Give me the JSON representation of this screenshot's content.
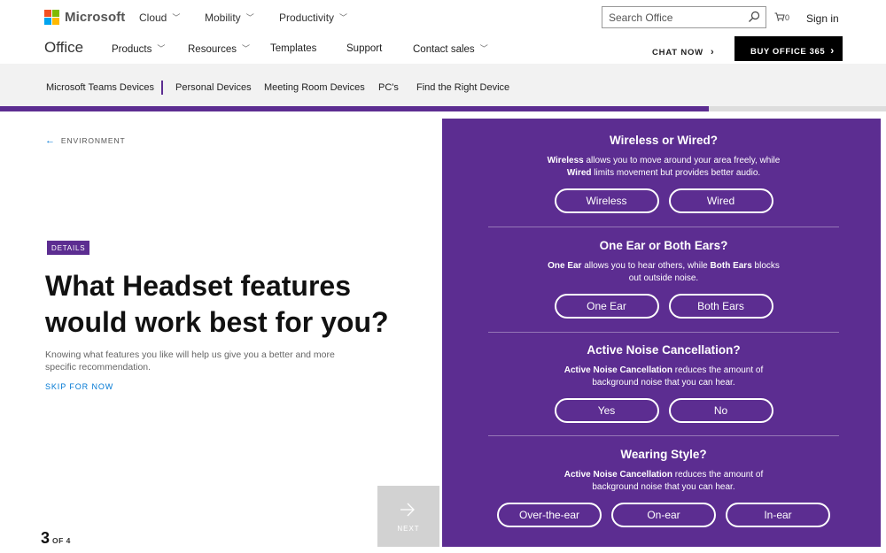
{
  "colors": {
    "accent": "#5c2d91",
    "link": "#0078d4",
    "ms_red": "#f25022",
    "ms_green": "#7fba00",
    "ms_blue": "#00a4ef",
    "ms_yellow": "#ffb900"
  },
  "header": {
    "brand": "Microsoft",
    "nav": [
      "Cloud",
      "Mobility",
      "Productivity"
    ],
    "search_placeholder": "Search Office",
    "cart_count": "0",
    "sign_in": "Sign in"
  },
  "office_nav": {
    "title": "Office",
    "items": [
      "Products",
      "Resources",
      "Templates",
      "Support",
      "Contact sales"
    ],
    "chat": "CHAT NOW",
    "buy": "BUY OFFICE 365"
  },
  "subnav": [
    "Microsoft Teams Devices",
    "Personal Devices",
    "Meeting Room Devices",
    "PC's",
    "Find the Right Device"
  ],
  "progress": 0.8,
  "main": {
    "back": "ENVIRONMENT",
    "badge": "DETAILS",
    "heading": "What Headset features would work best for you?",
    "description": "Knowing what features you like will help us give you a better and more specific recommendation.",
    "skip": "SKIP FOR NOW",
    "step_current": "3",
    "step_total": "OF 4",
    "next": "NEXT"
  },
  "questions": [
    {
      "title": "Wireless or Wired?",
      "desc": [
        {
          "bold": "Wireless",
          "text": " allows you to move around your area freely, while"
        },
        {
          "bold": "Wired",
          "text": " limits movement but provides better audio."
        }
      ],
      "options": [
        "Wireless",
        "Wired"
      ]
    },
    {
      "title": "One Ear or Both Ears?",
      "desc": [
        {
          "bold": "One Ear",
          "text": " allows you to hear others, while ",
          "bold2": "Both Ears",
          "text2": " blocks"
        },
        {
          "bold": "",
          "text": "out outside noise."
        }
      ],
      "options": [
        "One Ear",
        "Both Ears"
      ]
    },
    {
      "title": "Active Noise Cancellation?",
      "desc": [
        {
          "bold": "Active Noise Cancellation",
          "text": " reduces the amount of"
        },
        {
          "bold": "",
          "text": "background noise that you can hear."
        }
      ],
      "options": [
        "Yes",
        "No"
      ]
    },
    {
      "title": "Wearing Style?",
      "desc": [
        {
          "bold": "Active Noise Cancellation",
          "text": " reduces the amount of"
        },
        {
          "bold": "",
          "text": "background noise that you can hear."
        }
      ],
      "options": [
        "Over-the-ear",
        "On-ear",
        "In-ear"
      ]
    }
  ]
}
